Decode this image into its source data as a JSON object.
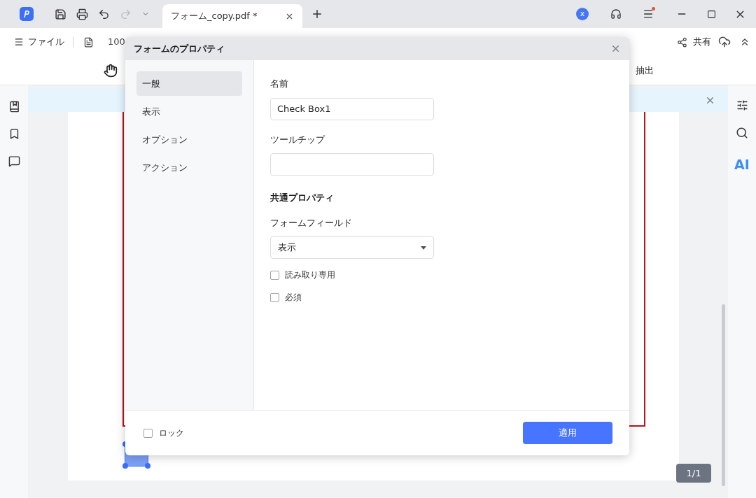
{
  "title_bar": {
    "tab_title": "フォーム_copy.pdf *",
    "account_initial": "x"
  },
  "toolbar": {
    "file_menu": "ファイル",
    "zoom": "100",
    "share": "共有",
    "extract": "抽出"
  },
  "right_sidebar": {
    "ai_label": "AI"
  },
  "document": {
    "page_indicator": "1/1"
  },
  "dialog": {
    "title": "フォームのプロパティ",
    "nav": [
      {
        "label": "一般",
        "selected": true
      },
      {
        "label": "表示",
        "selected": false
      },
      {
        "label": "オプション",
        "selected": false
      },
      {
        "label": "アクション",
        "selected": false
      }
    ],
    "name": {
      "label": "名前",
      "value": "Check Box1"
    },
    "tooltip": {
      "label": "ツールチップ"
    },
    "section_title": "共通プロパティ",
    "form_field": {
      "label": "フォームフィールド",
      "value": "表示"
    },
    "checkboxes": [
      {
        "label": "読み取り専用",
        "checked": false
      },
      {
        "label": "必須",
        "checked": false
      }
    ],
    "lock": {
      "label": "ロック",
      "checked": false
    },
    "apply_button": "適用"
  }
}
